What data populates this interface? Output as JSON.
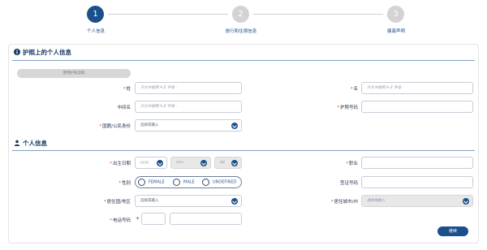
{
  "stepper": {
    "steps": [
      {
        "number": "1",
        "label": "个人信息"
      },
      {
        "number": "2",
        "label": "旅行和住宿信息"
      },
      {
        "number": "3",
        "label": "健康声明"
      }
    ]
  },
  "passport_section": {
    "title": "护照上的个人信息",
    "use_passport_button": "使用护照读取",
    "surname": {
      "label": "姓",
      "placeholder": "只允许使用 A-Z 字母 -"
    },
    "given_name": {
      "label": "名",
      "placeholder": "只允许使用 A-Z 字母 -"
    },
    "middle_name": {
      "label": "中间名",
      "placeholder": "只允许使用 A-Z 字母 -"
    },
    "passport_number": {
      "label": "护照号码",
      "placeholder": ""
    },
    "nationality": {
      "label": "国籍/公民身份",
      "placeholder": "选择或输入"
    }
  },
  "personal_section": {
    "title": "个人信息",
    "dob": {
      "label": "出生日期",
      "year": "yyyy",
      "month": "mm",
      "day": "dd"
    },
    "occupation": {
      "label": "职业",
      "placeholder": ""
    },
    "gender": {
      "label": "性别",
      "options": [
        "FEMALE",
        "MALE",
        "UNDEFINED"
      ]
    },
    "visa_number": {
      "label": "签证号码",
      "placeholder": ""
    },
    "country_of_residence": {
      "label": "居住国/地区",
      "placeholder": "选择或输入"
    },
    "city_of_residence": {
      "label": "居住城市/州",
      "placeholder": "选择或输入"
    },
    "phone": {
      "label": "电话号码",
      "prefix": "+"
    }
  },
  "actions": {
    "next_label": "继续"
  },
  "colors": {
    "primary": "#1b4f8c",
    "required": "#e0312d",
    "inactive_step": "#d3d3d3"
  }
}
